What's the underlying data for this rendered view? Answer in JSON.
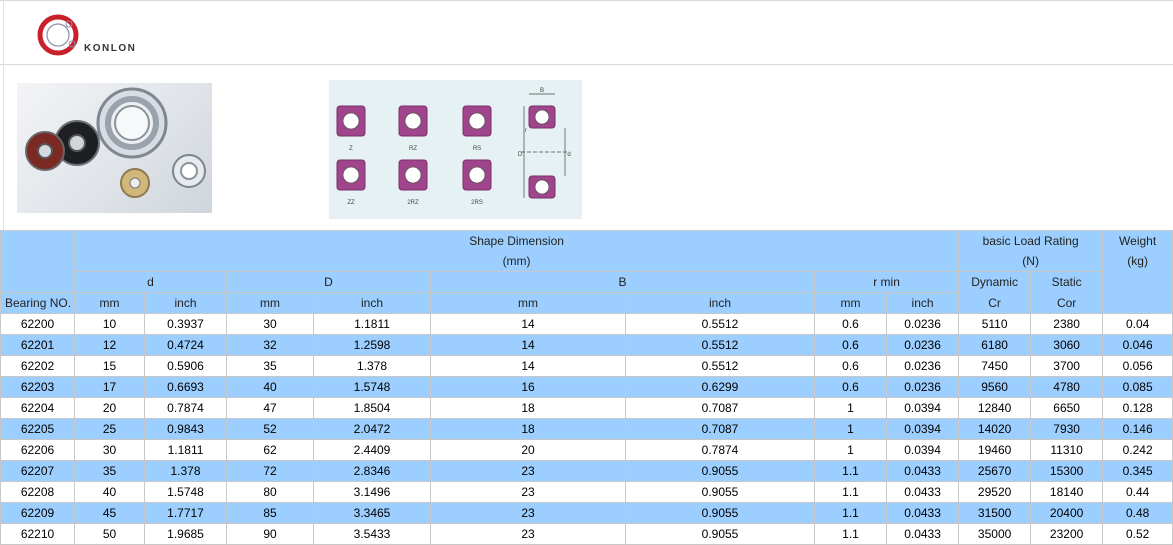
{
  "logo": {
    "brand": "KONLON"
  },
  "images": {
    "photo_label": "bearings-photo",
    "diagram_labels": [
      "Z",
      "RZ",
      "RS",
      "ZZ",
      "2RZ",
      "2RS"
    ],
    "diagram_dim_labels": [
      "B",
      "D",
      "d",
      "r"
    ]
  },
  "table": {
    "header": {
      "shape_dimension": "Shape Dimension",
      "shape_unit": "(mm)",
      "basic_load_rating": "basic Load Rating",
      "load_unit": "(N)",
      "weight": "Weight",
      "weight_unit": "(kg)",
      "d": "d",
      "D": "D",
      "B": "B",
      "rmin": "r min",
      "dynamic": "Dynamic",
      "static": "Static",
      "bearing_no": "Bearing NO.",
      "mm": "mm",
      "inch": "inch",
      "cr": "Cr",
      "cor": "Cor"
    },
    "rows": [
      [
        "62200",
        "10",
        "0.3937",
        "30",
        "1.1811",
        "14",
        "0.5512",
        "0.6",
        "0.0236",
        "5110",
        "2380",
        "0.04"
      ],
      [
        "62201",
        "12",
        "0.4724",
        "32",
        "1.2598",
        "14",
        "0.5512",
        "0.6",
        "0.0236",
        "6180",
        "3060",
        "0.046"
      ],
      [
        "62202",
        "15",
        "0.5906",
        "35",
        "1.378",
        "14",
        "0.5512",
        "0.6",
        "0.0236",
        "7450",
        "3700",
        "0.056"
      ],
      [
        "62203",
        "17",
        "0.6693",
        "40",
        "1.5748",
        "16",
        "0.6299",
        "0.6",
        "0.0236",
        "9560",
        "4780",
        "0.085"
      ],
      [
        "62204",
        "20",
        "0.7874",
        "47",
        "1.8504",
        "18",
        "0.7087",
        "1",
        "0.0394",
        "12840",
        "6650",
        "0.128"
      ],
      [
        "62205",
        "25",
        "0.9843",
        "52",
        "2.0472",
        "18",
        "0.7087",
        "1",
        "0.0394",
        "14020",
        "7930",
        "0.146"
      ],
      [
        "62206",
        "30",
        "1.1811",
        "62",
        "2.4409",
        "20",
        "0.7874",
        "1",
        "0.0394",
        "19460",
        "11310",
        "0.242"
      ],
      [
        "62207",
        "35",
        "1.378",
        "72",
        "2.8346",
        "23",
        "0.9055",
        "1.1",
        "0.0433",
        "25670",
        "15300",
        "0.345"
      ],
      [
        "62208",
        "40",
        "1.5748",
        "80",
        "3.1496",
        "23",
        "0.9055",
        "1.1",
        "0.0433",
        "29520",
        "18140",
        "0.44"
      ],
      [
        "62209",
        "45",
        "1.7717",
        "85",
        "3.3465",
        "23",
        "0.9055",
        "1.1",
        "0.0433",
        "31500",
        "20400",
        "0.48"
      ],
      [
        "62210",
        "50",
        "1.9685",
        "90",
        "3.5433",
        "23",
        "0.9055",
        "1.1",
        "0.0433",
        "35000",
        "23200",
        "0.52"
      ]
    ]
  },
  "colors": {
    "header_blue": "#9ccfff",
    "ring_purple": "#a0458c"
  }
}
